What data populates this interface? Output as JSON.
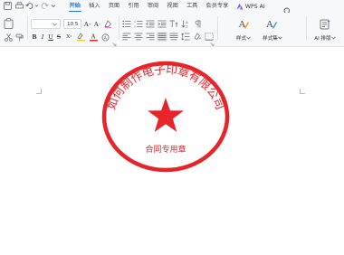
{
  "menubar": {
    "tabs": [
      {
        "label": "开始",
        "active": true
      },
      {
        "label": "插入",
        "active": false
      },
      {
        "label": "页面",
        "active": false
      },
      {
        "label": "引用",
        "active": false
      },
      {
        "label": "审阅",
        "active": false
      },
      {
        "label": "视图",
        "active": false
      },
      {
        "label": "工具",
        "active": false
      },
      {
        "label": "会员专享",
        "active": false
      }
    ],
    "ai_tab": "WPS AI"
  },
  "ribbon": {
    "font_size": "10.5",
    "style_label": "样式",
    "ai_layout_label": "AI 排版"
  },
  "seal": {
    "company_name": "如何制作电子印章有限公司",
    "seal_type": "合同专用章",
    "color": "#e8242b"
  },
  "colors": {
    "accent": "#1a73e8",
    "ribbon_bg": "#f7f8fa"
  }
}
